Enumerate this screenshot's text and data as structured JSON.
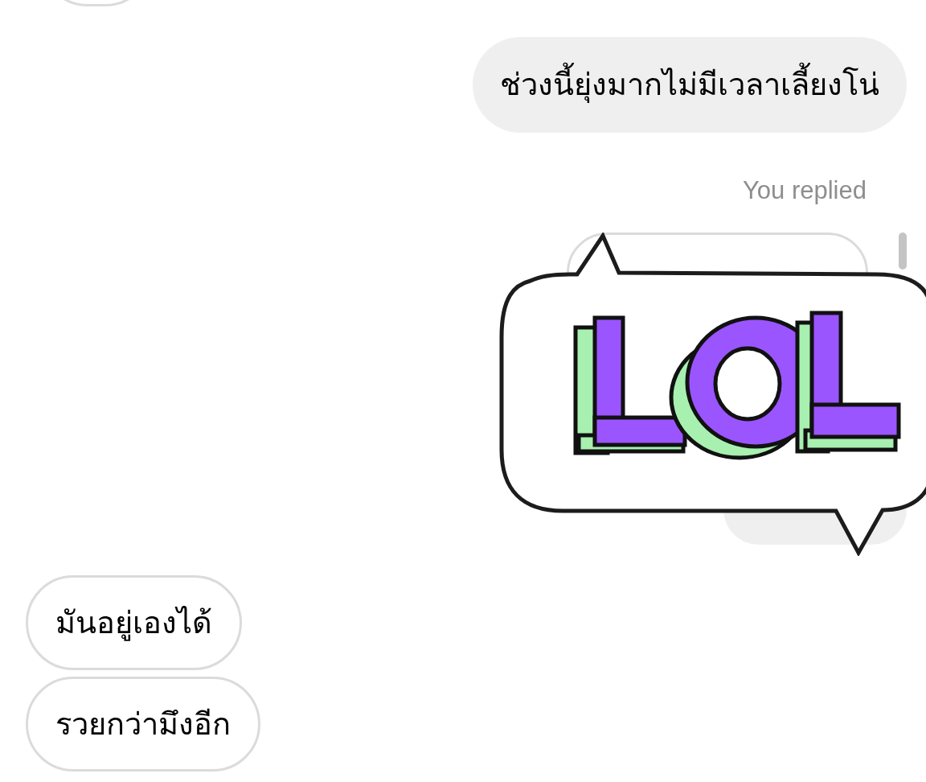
{
  "messages": [
    {
      "kind": "text",
      "outgoing": true,
      "text": "ช่วงนี้ยุ่งมากไม่มีเวลาเลี้ยงโน่"
    },
    {
      "kind": "reply",
      "label": "You replied"
    },
    {
      "kind": "text",
      "outgoing": false,
      "text": "มันอยู่เองได้"
    },
    {
      "kind": "text",
      "outgoing": false,
      "text": "รวยกว่ามึงอีก"
    }
  ]
}
